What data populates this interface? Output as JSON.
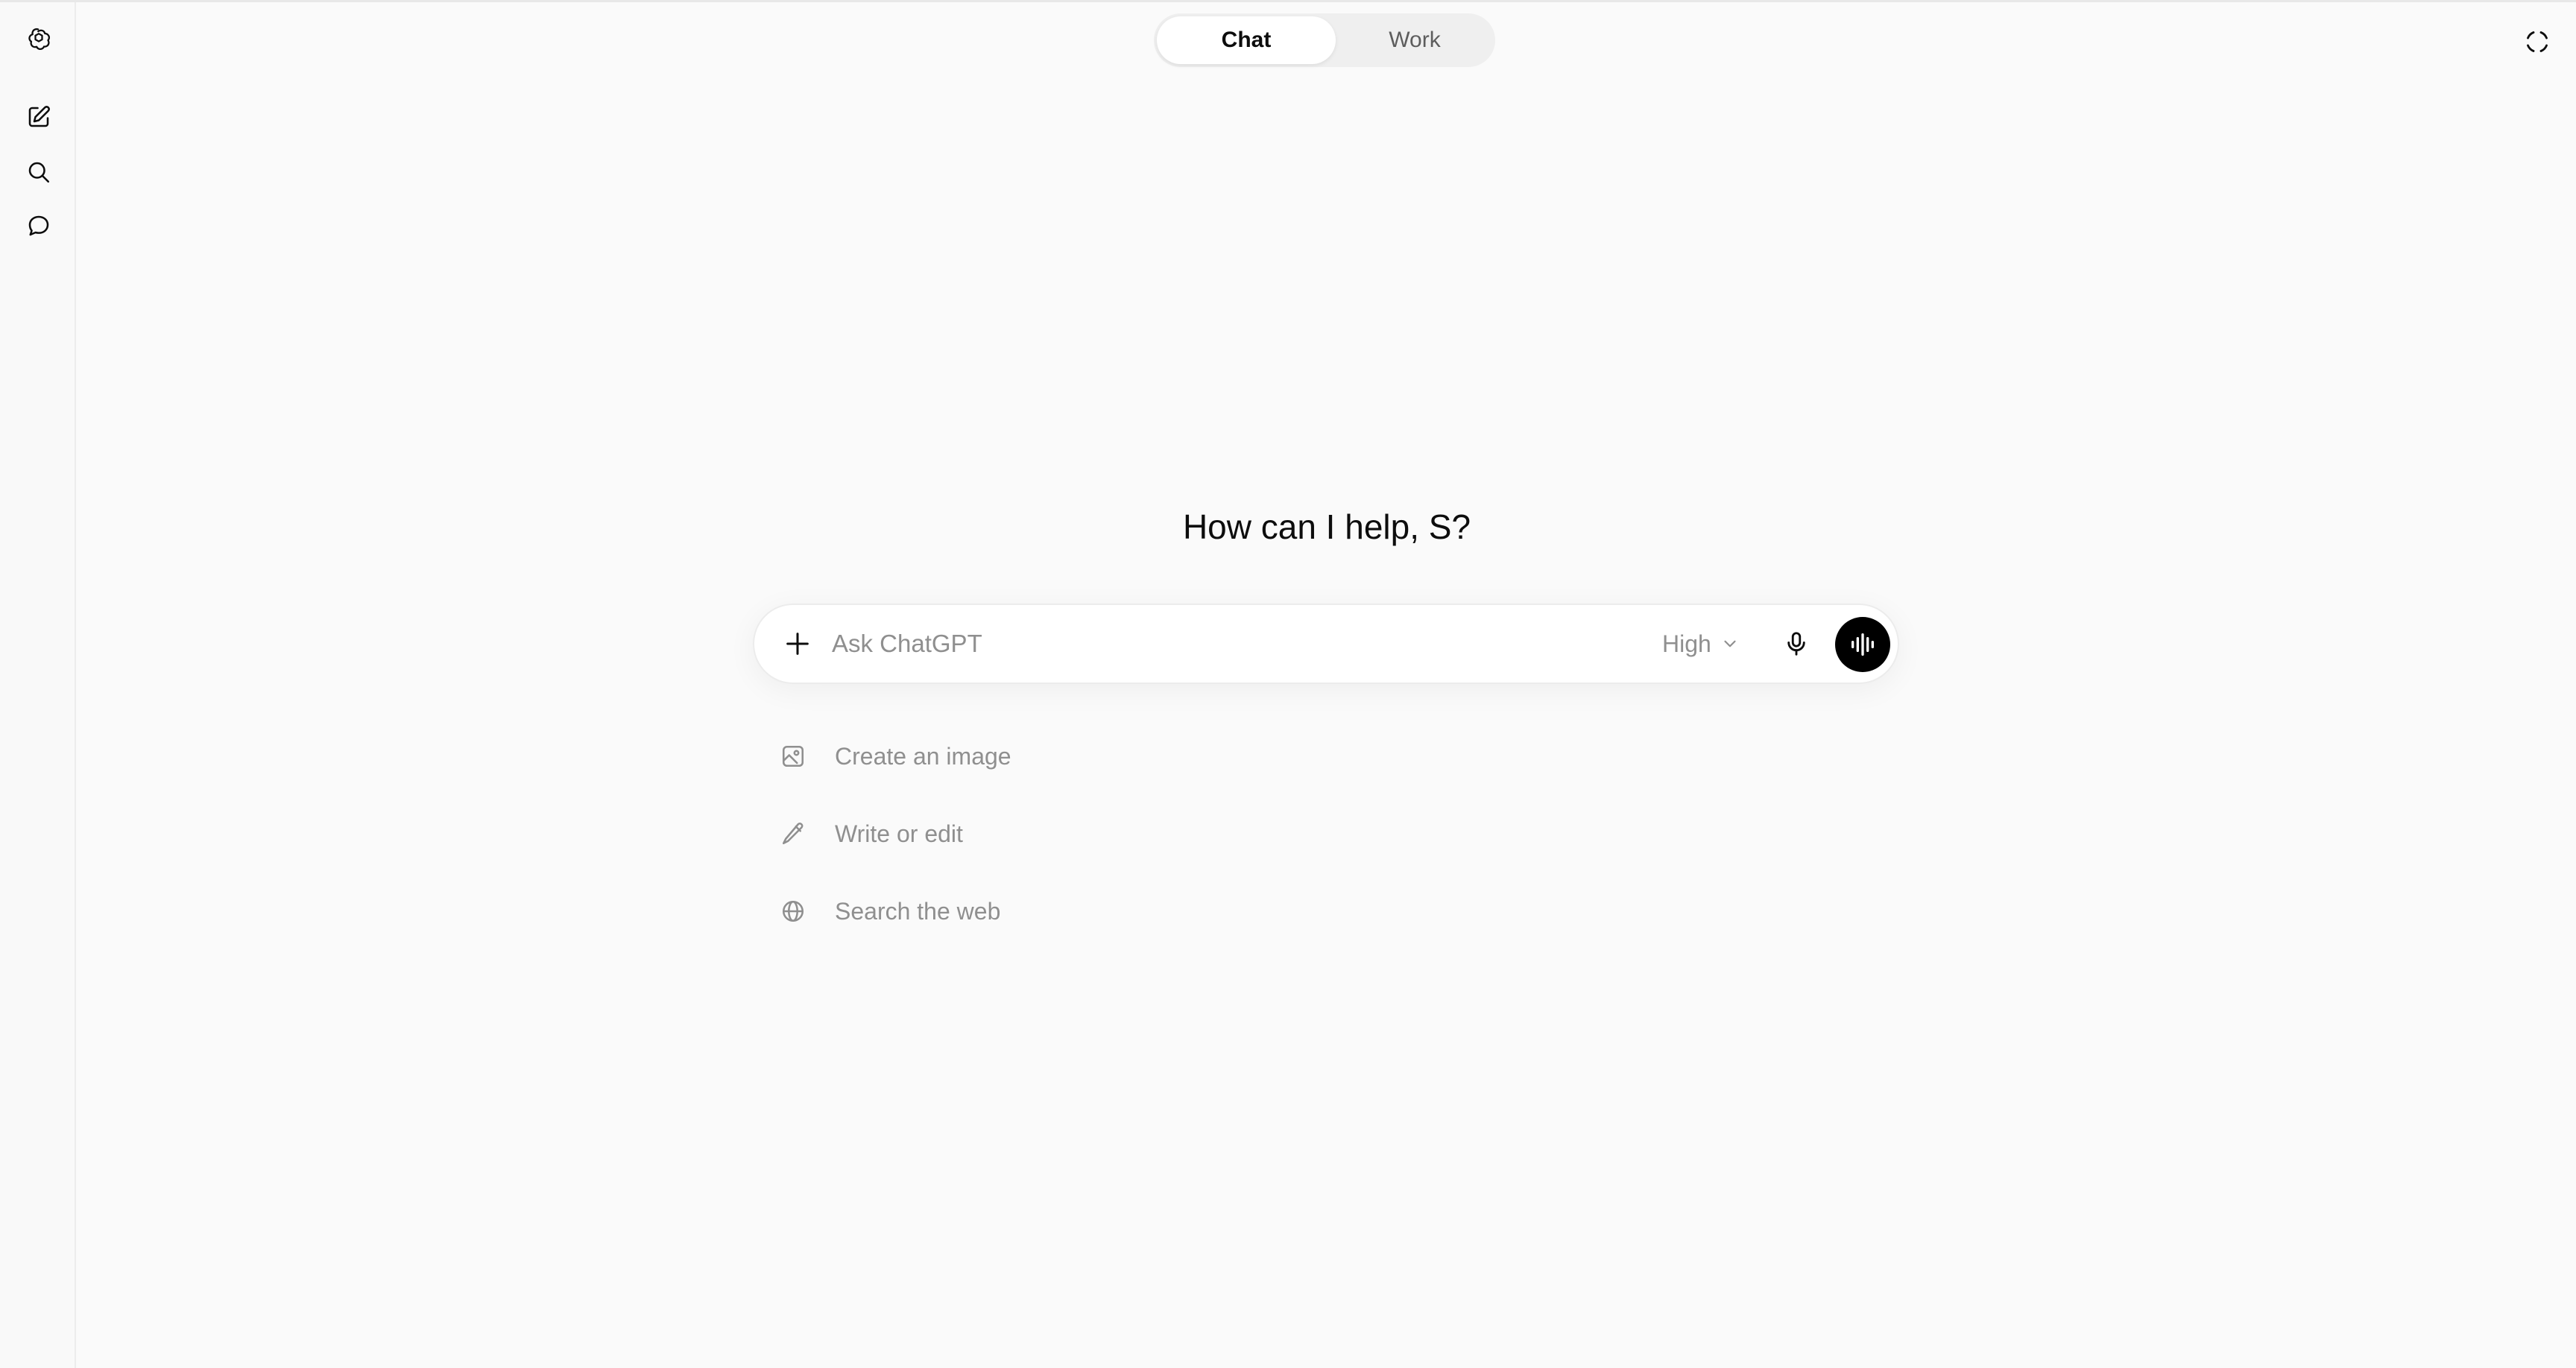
{
  "sidebar": {
    "items": [
      {
        "icon": "logo-icon"
      },
      {
        "icon": "new-chat-icon"
      },
      {
        "icon": "search-icon"
      },
      {
        "icon": "chat-bubble-icon"
      }
    ]
  },
  "header": {
    "tabs": [
      {
        "label": "Chat",
        "active": true
      },
      {
        "label": "Work",
        "active": false
      }
    ],
    "corner_icon": "temporary-chat-icon"
  },
  "main": {
    "greeting": "How can I help, S?",
    "composer": {
      "placeholder": "Ask ChatGPT",
      "value": "",
      "model_level": "High"
    },
    "suggestions": [
      {
        "label": "Create an image",
        "icon": "image-icon"
      },
      {
        "label": "Write or edit",
        "icon": "pencil-icon"
      },
      {
        "label": "Search the web",
        "icon": "globe-icon"
      }
    ]
  },
  "colors": {
    "background": "#fafafa",
    "voice_button": "#000000",
    "muted_text": "#8f8f8f"
  }
}
